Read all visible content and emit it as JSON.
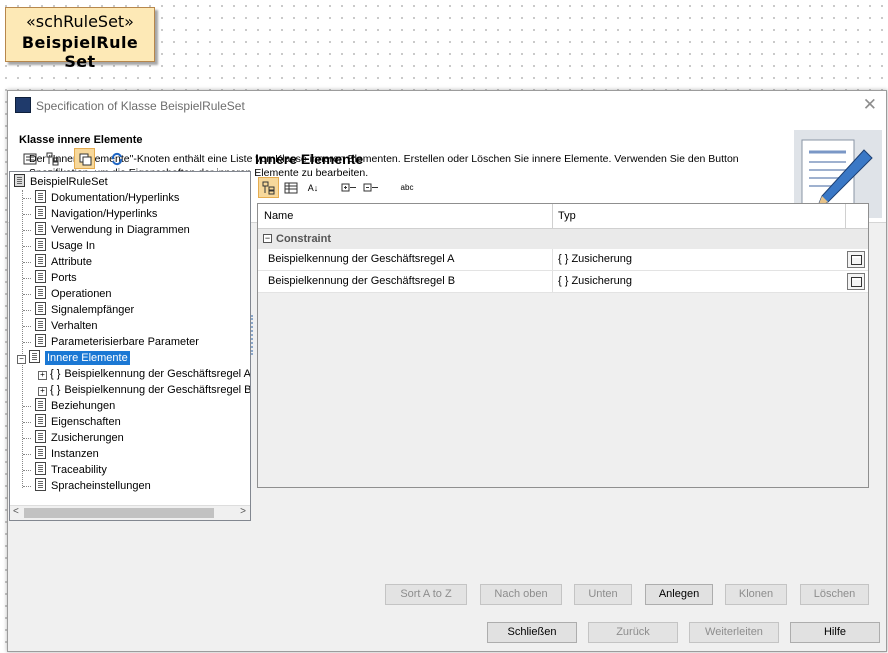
{
  "diagram": {
    "stereotype": "«schRuleSet»",
    "name": "BeispielRule Set"
  },
  "dialog": {
    "title": "Specification of Klasse BeispielRuleSet",
    "header": {
      "heading": "Klasse innere Elemente",
      "description": "Der \"Innere Elemente\"-Knoten enthält eine Liste von Klasse inneren Elementen. Erstellen oder Löschen Sie innere Elemente. Verwenden Sie den Button Spezifikation, um die Eigenschaften der inneren Elemente zu bearbeiten."
    },
    "tree": {
      "root": "BeispielRuleSet",
      "items": [
        "Dokumentation/Hyperlinks",
        "Navigation/Hyperlinks",
        "Verwendung in Diagrammen",
        "Usage In",
        "Attribute",
        "Ports",
        "Operationen",
        "Signalempfänger",
        "Verhalten",
        "Parameterisierbare Parameter",
        "Innere Elemente"
      ],
      "children": [
        "Beispielkennung der Geschäftsregel A",
        "Beispielkennung der Geschäftsregel B"
      ],
      "items_after": [
        "Beziehungen",
        "Eigenschaften",
        "Zusicherungen",
        "Instanzen",
        "Traceability",
        "Spracheinstellungen"
      ],
      "selected": "Innere Elemente"
    },
    "panel": {
      "title": "Innere Elemente",
      "columns": [
        "Name",
        "Typ"
      ],
      "group": "Constraint",
      "rows": [
        {
          "name": "Beispielkennung der Geschäftsregel A",
          "type": "{ }  Zusicherung"
        },
        {
          "name": "Beispielkennung der Geschäftsregel B",
          "type": "{ }  Zusicherung"
        }
      ]
    },
    "grid_buttons": [
      "Sort A to Z",
      "Nach oben",
      "Unten",
      "Anlegen",
      "Klonen",
      "Löschen"
    ],
    "footer_buttons": [
      "Schließen",
      "Zurück",
      "Weiterleiten",
      "Hilfe"
    ]
  }
}
